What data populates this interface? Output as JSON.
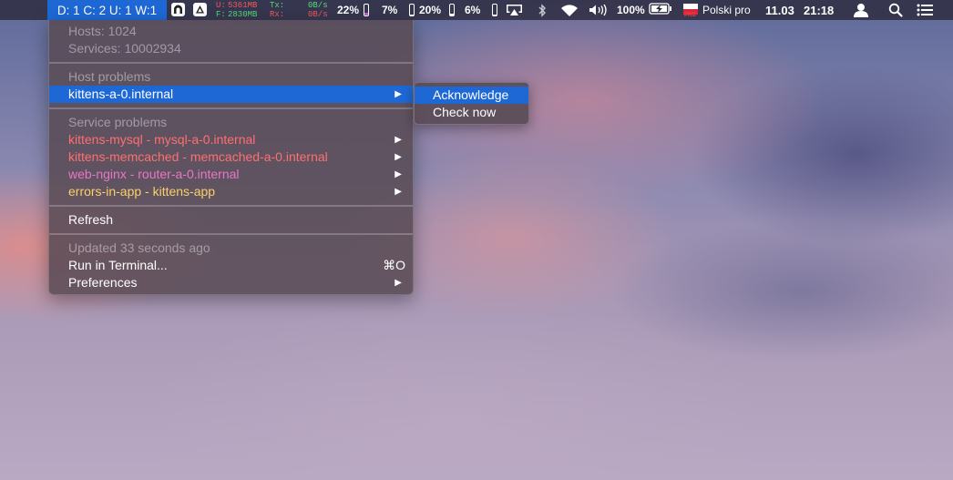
{
  "menubar": {
    "status": "D: 1 C: 2 U: 1 W:1",
    "mem": {
      "used_label": "U:",
      "used": "5361MB",
      "free_label": "F:",
      "free": "2830MB"
    },
    "net": {
      "tx_label": "Tx:",
      "tx": "0B/s",
      "rx_label": "Rx:",
      "rx": "0B/s"
    },
    "cpu": "22%",
    "cpu_level": 0.22,
    "gpu": "7%",
    "gpu_level": 0.07,
    "disk": "20%",
    "disk_level": 0.2,
    "other": "6%",
    "other_level": 0.06,
    "battery": "100%",
    "input_source_badge": "PRO",
    "input_source": "Polski pro",
    "date": "11.03",
    "time": "21:18",
    "colors": {
      "highlight": "#1e68d6",
      "cpu_bar": "#c05fd8"
    }
  },
  "menu": {
    "hosts": "Hosts: 1024",
    "services": "Services: 10002934",
    "host_problems_header": "Host problems",
    "host_problems": [
      {
        "label": "kittens-a-0.internal",
        "arrow": "▶"
      }
    ],
    "service_problems_header": "Service problems",
    "service_problems": [
      {
        "label": "kittens-mysql - mysql-a-0.internal",
        "arrow": "▶",
        "color": "#ff6f6f"
      },
      {
        "label": "kittens-memcached - memcached-a-0.internal",
        "arrow": "▶",
        "color": "#ff6f6f"
      },
      {
        "label": "web-nginx - router-a-0.internal",
        "arrow": "▶",
        "color": "#e876c4"
      },
      {
        "label": "errors-in-app - kittens-app",
        "arrow": "▶",
        "color": "#f9d06a"
      }
    ],
    "refresh": "Refresh",
    "updated": "Updated 33 seconds ago",
    "run_terminal": "Run in Terminal...",
    "run_terminal_shortcut": "⌘O",
    "preferences": "Preferences",
    "preferences_arrow": "▶"
  },
  "submenu": {
    "acknowledge": "Acknowledge",
    "check_now": "Check now"
  }
}
